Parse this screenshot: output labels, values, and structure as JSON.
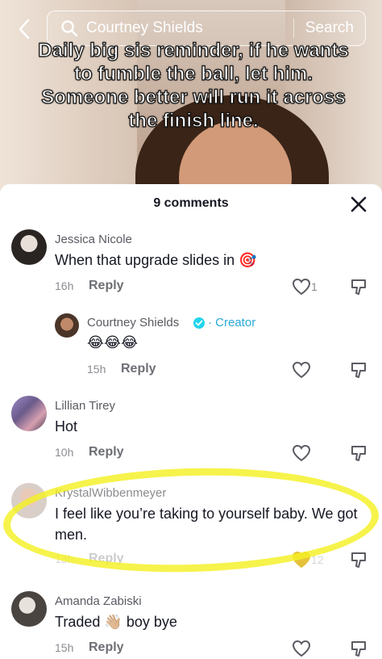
{
  "search": {
    "query": "Courtney Shields",
    "button_label": "Search"
  },
  "video": {
    "caption": "Daily big sis reminder, if he wants to fumble the ball, let him. Someone better will run it across the finish line."
  },
  "comments_panel": {
    "title": "9 comments",
    "comments": [
      {
        "username": "Jessica Nicole",
        "text": "When that upgrade slides in",
        "emoji": "🎯",
        "time": "16h",
        "reply_label": "Reply",
        "likes": "1",
        "replies": [
          {
            "username": "Courtney Shields",
            "creator_label": "Creator",
            "text": "😂😂😂",
            "time": "15h",
            "reply_label": "Reply"
          }
        ]
      },
      {
        "username": "Lillian Tirey",
        "text": "Hot",
        "time": "10h",
        "reply_label": "Reply"
      },
      {
        "username": "KrystalWibbenmeyer",
        "text": "I feel like you’re taking to yourself baby. We got men.",
        "time": "13h",
        "reply_label": "Reply",
        "likes": "12"
      },
      {
        "username": "Amanda Zabiski",
        "text_before": "Traded",
        "emoji": "👋🏼",
        "text_after": "boy bye",
        "time": "15h",
        "reply_label": "Reply"
      }
    ]
  },
  "colors": {
    "highlight": "#f4f024",
    "creator_accent": "#2aa9d6",
    "text_primary": "#161823",
    "text_secondary": "#8a8b91"
  },
  "icons": [
    "back-icon",
    "search-icon",
    "close-icon",
    "heart-icon",
    "dislike-icon",
    "verified-icon"
  ]
}
